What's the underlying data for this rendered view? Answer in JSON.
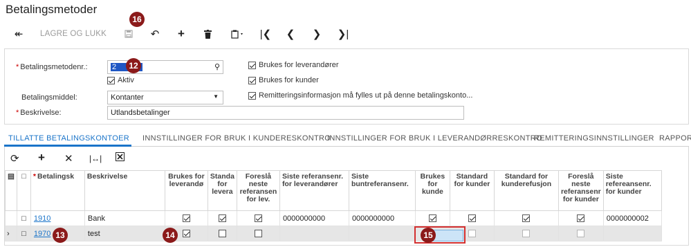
{
  "page": {
    "title": "Betalingsmetoder"
  },
  "toolbar": {
    "save_close_label": "LAGRE OG LUKK"
  },
  "badges": {
    "b12": "12",
    "b13": "13",
    "b14": "14",
    "b15": "15",
    "b16": "16"
  },
  "form": {
    "method_id_label": "Betalingsmetodenr.:",
    "method_id_value": "2",
    "active_label": "Aktiv",
    "payment_means_label": "Betalingsmiddel:",
    "payment_means_value": "Kontanter",
    "description_label": "Beskrivelse:",
    "description_value": "Utlandsbetalinger",
    "use_for_vendors_label": "Brukes for leverandører",
    "use_for_customers_label": "Brukes for kunder",
    "remittance_label": "Remitteringsinformasjon må fylles ut på denne betalingskonto..."
  },
  "tabs": [
    {
      "label": "TILLATTE BETALINGSKONTOER"
    },
    {
      "label": "INNSTILLINGER FOR BRUK I KUNDERESKONTRO"
    },
    {
      "label": "INNSTILLINGER FOR BRUK I LEVERANDØRRESKONTRO"
    },
    {
      "label": "REMITTERINGSINNSTILLINGER"
    },
    {
      "label": "RAPPORT"
    }
  ],
  "grid": {
    "columns": [
      "Betalingsk",
      "Beskrivelse",
      "Brukes for leverandø",
      "Standa for levera",
      "Foreslå neste referansen for lev.",
      "Siste referansenr. for leverandører",
      "Siste buntreferansenr.",
      "Brukes for kunde",
      "Standard for kunder",
      "Standard for kunderefusjon",
      "Foreslå neste referansenr for kunder",
      "Siste refereansenr. for kunder"
    ],
    "rows": [
      {
        "account": "1910",
        "description": "Bank",
        "last_ref_vendor": "0000000000",
        "last_batch_ref": "0000000000",
        "last_ref_customer": "0000000002"
      },
      {
        "account": "1970",
        "description": "test",
        "last_ref_vendor": "",
        "last_batch_ref": "",
        "last_ref_customer": ""
      }
    ]
  },
  "colors": {
    "accent": "#1a74c9",
    "badge": "#8b1a1a",
    "highlight": "#d32f2f"
  }
}
